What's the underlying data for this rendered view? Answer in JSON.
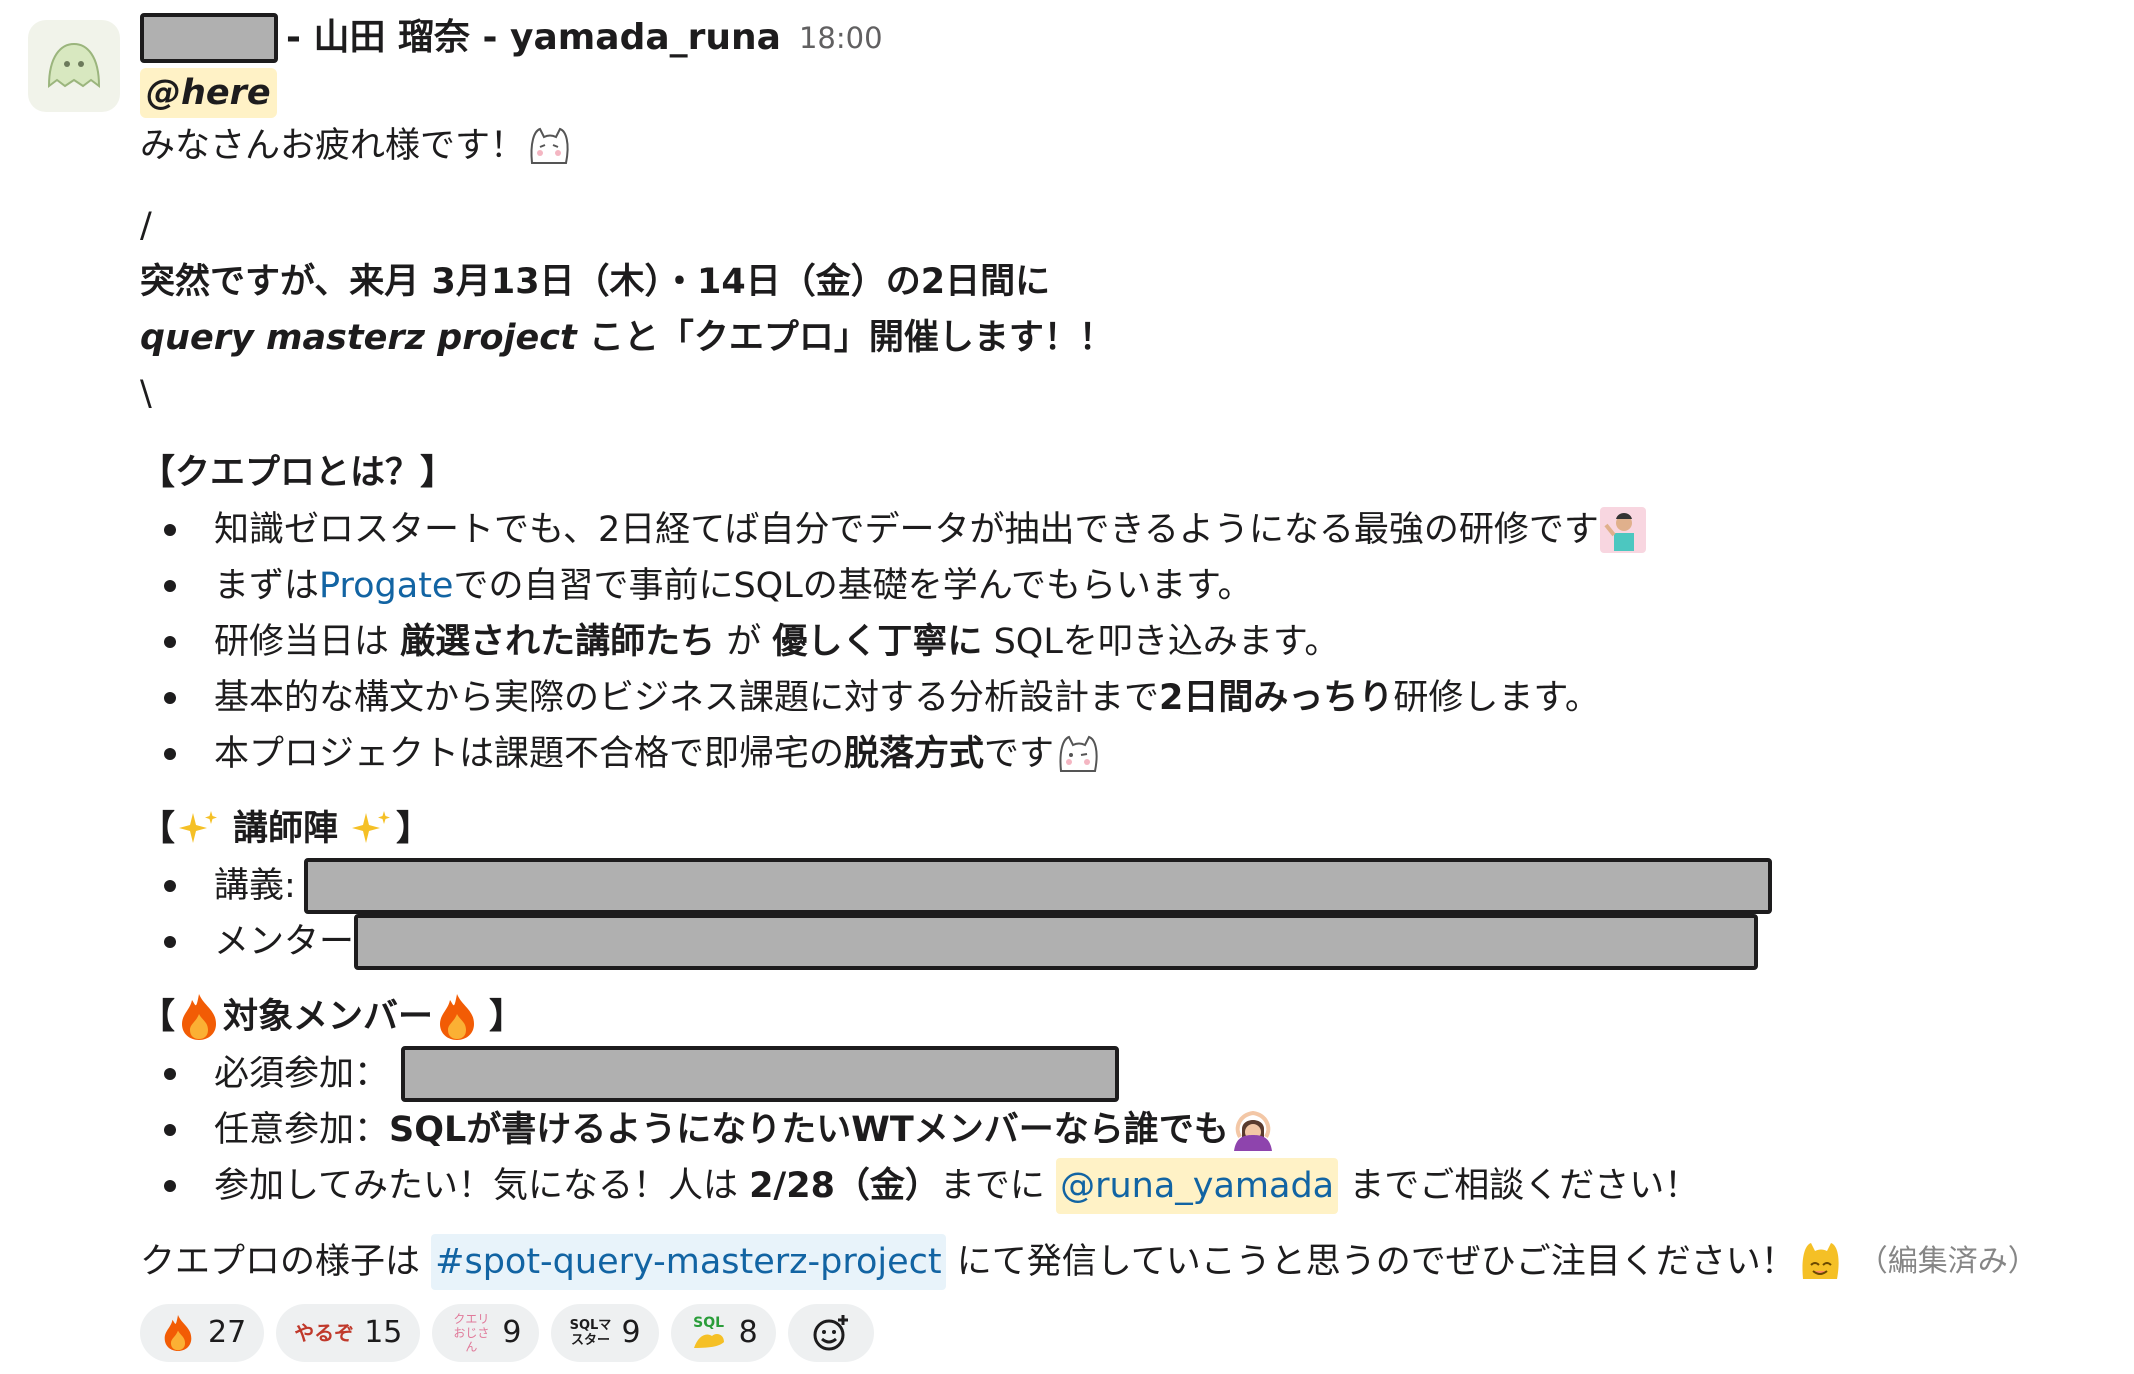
{
  "message": {
    "author_display": "- 山田 瑠奈 - yamada_runa",
    "time": "18:00",
    "here_mention": "@here",
    "greeting": "みなさんお疲れ様です！",
    "slash_open": "/",
    "announce_bold": "突然ですが、来月 3月13日（木）・14日（金）の2日間に",
    "project_italic": "query masterz project",
    "project_rest": " こと「クエプロ」開催します！！",
    "slash_close": "\\",
    "section_about": "【クエプロとは？】",
    "about_items": [
      "知識ゼロスタートでも、2日経てば自分でデータが抽出できるようになる最強の研修です",
      "まずは",
      "での自習で事前にSQLの基礎を学んでもらいます。"
    ],
    "progate_link": "Progate",
    "item3_a": "研修当日は ",
    "item3_b": "厳選された講師たち",
    "item3_c": " が ",
    "item3_d": "優しく丁寧に",
    "item3_e": " SQLを叩き込みます。",
    "item4_a": "基本的な構文から実際のビジネス課題に対する分析設計まで",
    "item4_b": "2日間みっちり",
    "item4_c": "研修します。",
    "item5_a": "本プロジェクトは課題不合格で即帰宅の",
    "item5_b": "脱落方式",
    "item5_c": "です",
    "section_teachers_open": "【",
    "section_teachers_title": "講師陣",
    "section_teachers_close": "】",
    "teacher_lecture_label": "講義:",
    "teacher_mentor_label": "メンター",
    "section_target_open": "【",
    "section_target_title": "対象メンバー",
    "section_target_close": "】",
    "target_required_label": "必須参加：",
    "target_optional_a": "任意参加：",
    "target_optional_b": "SQLが書けるようになりたいWTメンバーなら誰でも",
    "target_contact_a": "参加してみたい！気になる！人は ",
    "target_contact_b": "2/28（金）",
    "target_contact_c": "までに ",
    "target_contact_mention": "@runa_yamada",
    "target_contact_d": " までご相談ください！",
    "footer_a": "クエプロの様子は ",
    "footer_channel": "#spot-query-masterz-project",
    "footer_b": " にて発信していこうと思うのでぜひご注目ください！",
    "edited": "（編集済み）"
  },
  "reactions": [
    {
      "icon": "fire-icon",
      "label": "",
      "count": "27"
    },
    {
      "icon": "yaruzo-icon",
      "label": "やるぞ",
      "count": "15"
    },
    {
      "icon": "query-ojisan-icon",
      "label": "クエリおじさん",
      "count": "9"
    },
    {
      "icon": "sql-master-icon",
      "label": "SQLマスター",
      "count": "9"
    },
    {
      "icon": "sql-muscle-icon",
      "label": "SQL",
      "count": "8"
    }
  ],
  "colors": {
    "link": "#1264a3",
    "here_bg": "#fff2c6",
    "mention_bg": "#e8f3fa",
    "redaction": "#b0b0b0"
  }
}
